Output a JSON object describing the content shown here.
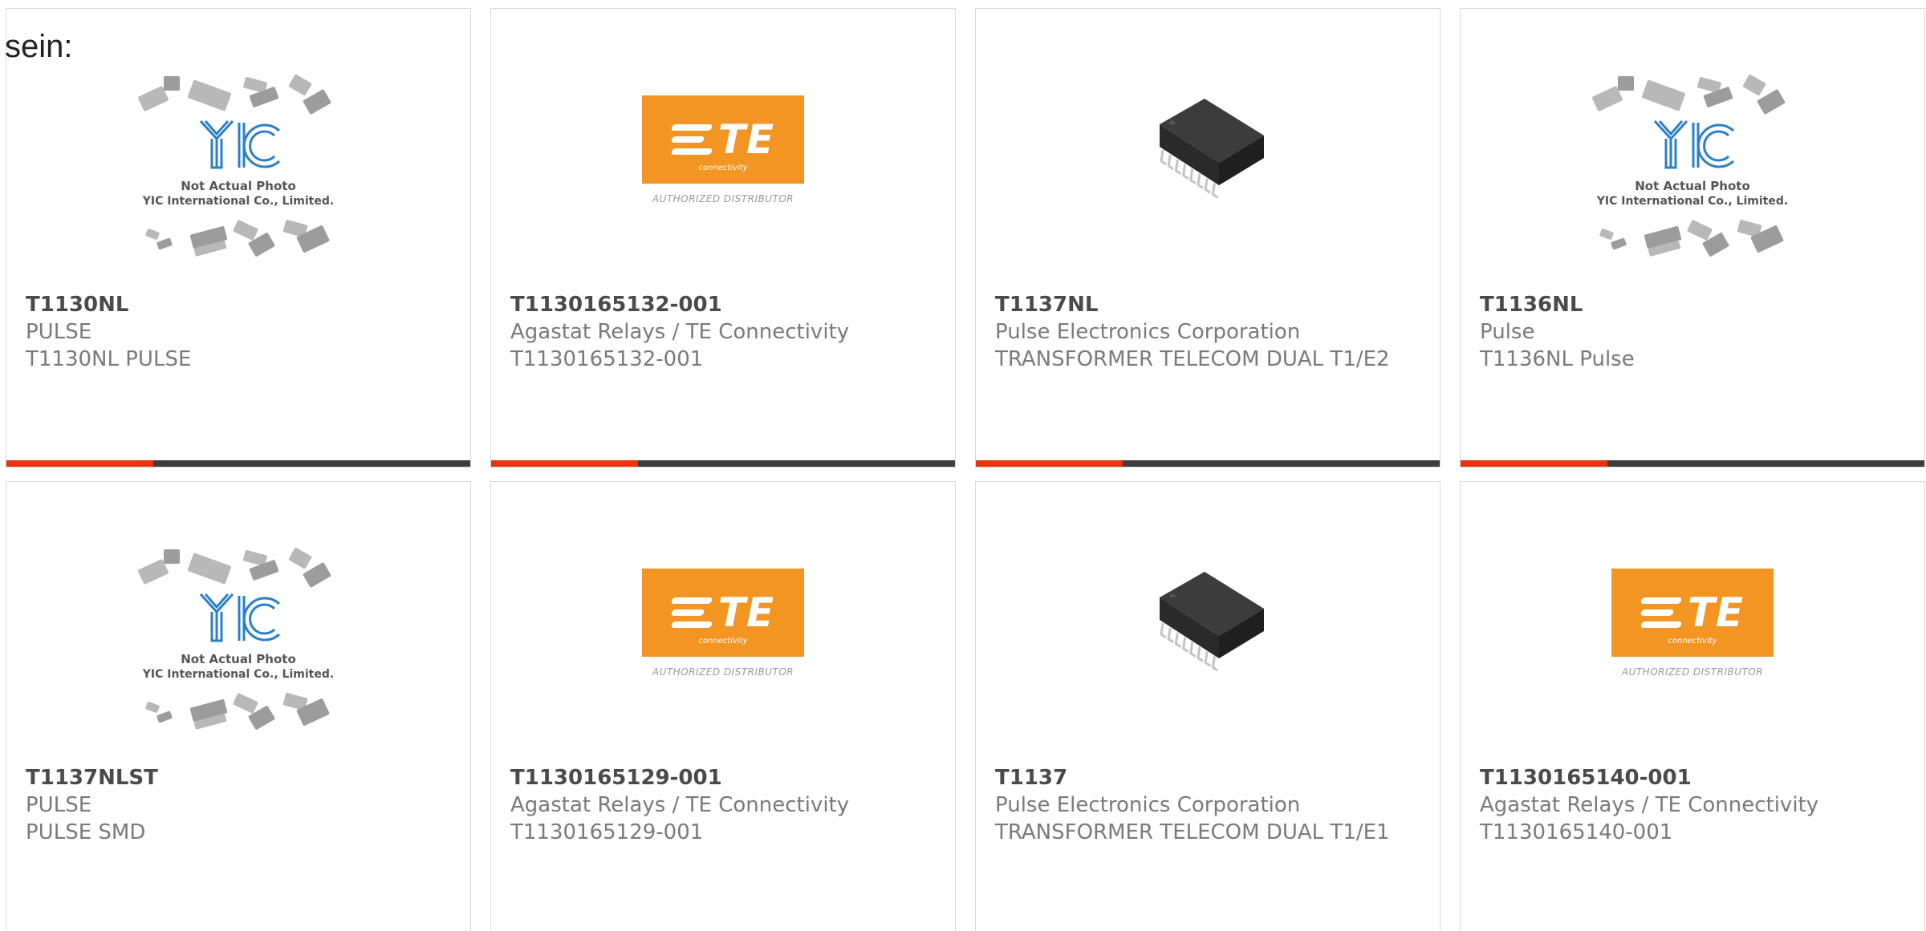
{
  "heading": "sein:",
  "colors": {
    "accent_red": "#e8330e",
    "bar_dark": "#3d3d3d",
    "te_orange": "#f39523",
    "yic_blue": "#2a7fc9"
  },
  "placeholders": {
    "yic": {
      "icon": "yic-placeholder-image",
      "line1": "Not Actual Photo",
      "line2": "YIC International Co., Limited."
    },
    "te": {
      "icon": "te-connectivity-logo",
      "mark": "TE",
      "sub": "connectivity",
      "caption": "AUTHORIZED DISTRIBUTOR"
    },
    "transformer": {
      "icon": "smd-transformer-image"
    }
  },
  "products": [
    {
      "part_number": "T1130NL",
      "manufacturer": "PULSE",
      "description": "T1130NL PULSE",
      "image": "yic"
    },
    {
      "part_number": "T1130165132-001",
      "manufacturer": "Agastat Relays / TE Connectivity",
      "description": "T1130165132-001",
      "image": "te"
    },
    {
      "part_number": "T1137NL",
      "manufacturer": "Pulse Electronics Corporation",
      "description": "TRANSFORMER TELECOM DUAL T1/E2",
      "image": "transformer"
    },
    {
      "part_number": "T1136NL",
      "manufacturer": "Pulse",
      "description": "T1136NL Pulse",
      "image": "yic"
    },
    {
      "part_number": "T1137NLST",
      "manufacturer": "PULSE",
      "description": "PULSE SMD",
      "image": "yic"
    },
    {
      "part_number": "T1130165129-001",
      "manufacturer": "Agastat Relays / TE Connectivity",
      "description": "T1130165129-001",
      "image": "te"
    },
    {
      "part_number": "T1137",
      "manufacturer": "Pulse Electronics Corporation",
      "description": "TRANSFORMER TELECOM DUAL T1/E1",
      "image": "transformer"
    },
    {
      "part_number": "T1130165140-001",
      "manufacturer": "Agastat Relays / TE Connectivity",
      "description": "T1130165140-001",
      "image": "te"
    }
  ]
}
